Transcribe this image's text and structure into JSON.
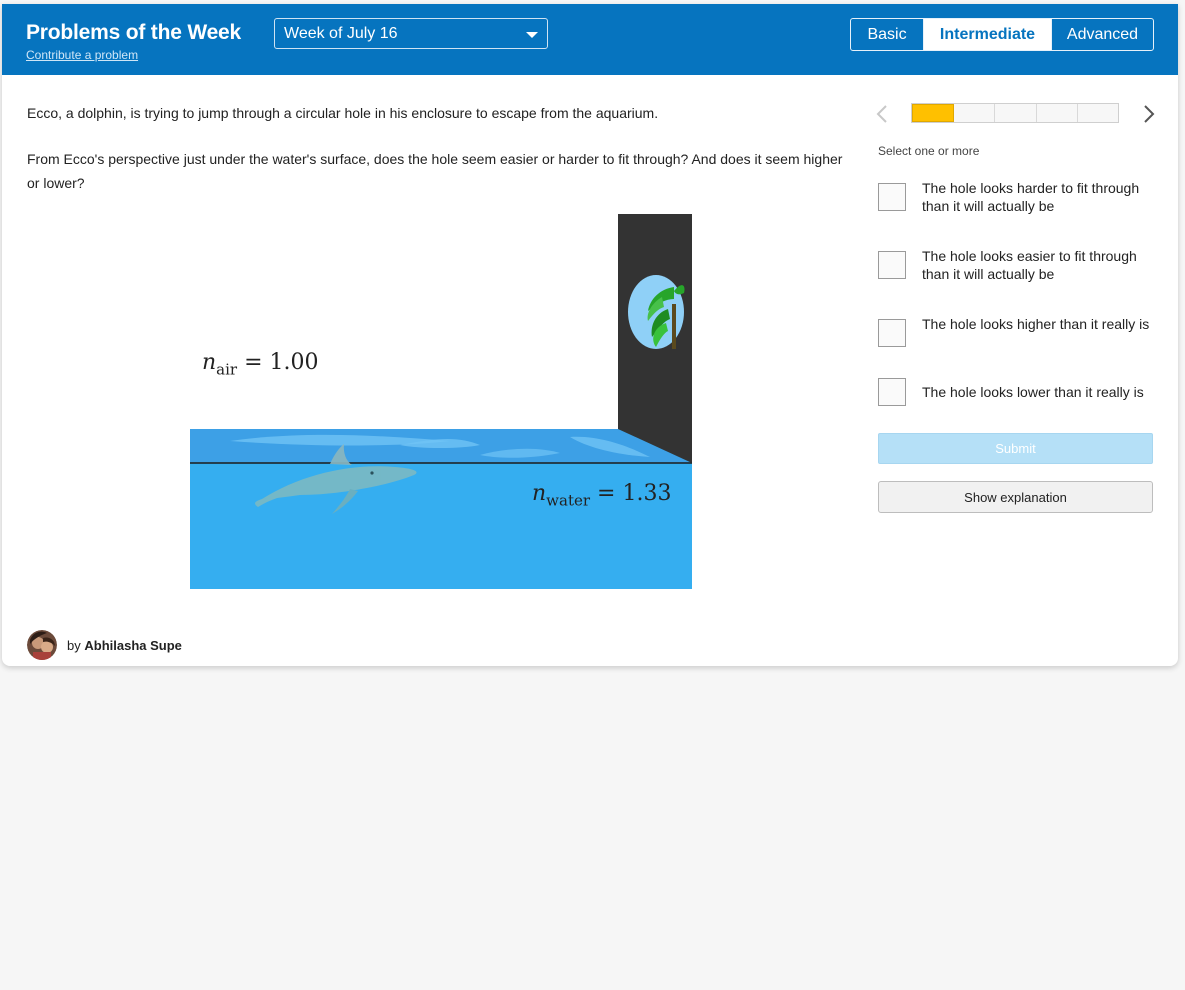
{
  "header": {
    "title": "Problems of the Week",
    "contribute_link": "Contribute a problem",
    "week_select": "Week of July 16",
    "levels": [
      "Basic",
      "Intermediate",
      "Advanced"
    ],
    "active_level": "Intermediate"
  },
  "problem": {
    "paragraph1": "Ecco, a dolphin, is trying to jump through a circular hole in his enclosure to escape from the aquarium.",
    "paragraph2": "From Ecco's perspective just under the water's surface, does the hole seem easier or harder to fit through? And does it seem higher or lower?",
    "figure": {
      "n_air": {
        "symbol": "n",
        "subscript": "air",
        "value": "= 1.00"
      },
      "n_water": {
        "symbol": "n",
        "subscript": "water",
        "value": "= 1.33"
      }
    }
  },
  "sidebar": {
    "progress": {
      "total_segments": 5,
      "current": 1
    },
    "prev_icon": "chevron-left-icon",
    "next_icon": "chevron-right-icon",
    "select_hint": "Select one or more",
    "options": [
      {
        "label": "The hole looks harder to fit through than it will actually be",
        "checked": false
      },
      {
        "label": "The hole looks easier to fit through than it will actually be",
        "checked": false
      },
      {
        "label": "The hole looks higher than it really is",
        "checked": false
      },
      {
        "label": "The hole looks lower than it really is",
        "checked": false
      }
    ],
    "submit_label": "Submit",
    "explanation_label": "Show explanation"
  },
  "author": {
    "prefix": "by",
    "name": "Abhilasha Supe"
  },
  "colors": {
    "header_blue": "#0674bf",
    "progress_yellow": "#ffc000",
    "submit_disabled": "#b5e0f7",
    "water": "#35aef0",
    "wall": "#333333"
  }
}
